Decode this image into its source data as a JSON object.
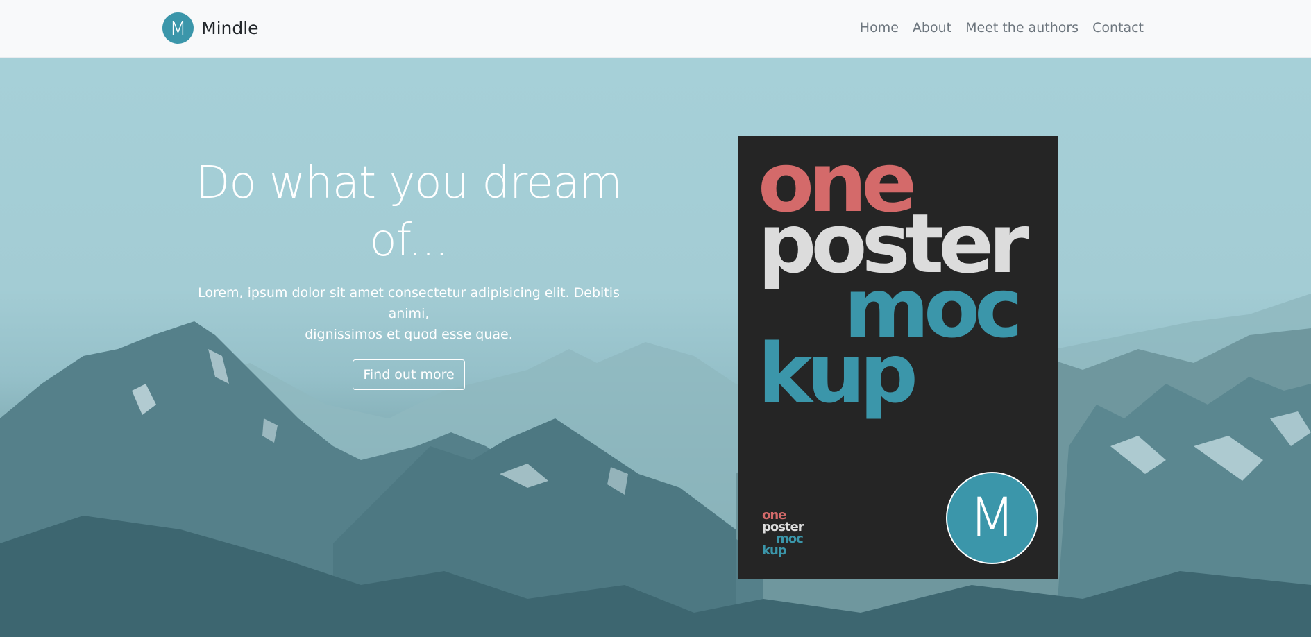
{
  "navbar": {
    "brand_initial": "M",
    "brand_name": "Mindle",
    "links": [
      {
        "label": "Home"
      },
      {
        "label": "About"
      },
      {
        "label": "Meet the authors"
      },
      {
        "label": "Contact"
      }
    ]
  },
  "hero": {
    "title_line1": "Do what you dream",
    "title_line2": "of...",
    "lead_line1": "Lorem, ipsum dolor sit amet consectetur adipisicing elit. Debitis animi,",
    "lead_line2": "dignissimos et quod esse quae.",
    "cta_label": "Find out more",
    "background": "mountain-landscape"
  },
  "poster": {
    "words": [
      "one",
      "poster",
      "moc",
      "kup"
    ],
    "mini_logo": [
      "one",
      "poster",
      "moc",
      "kup"
    ],
    "badge_initial": "M"
  },
  "colors": {
    "brand": "#3b96aa",
    "accent_red": "#d46a6a",
    "poster_bg": "#252525",
    "navbar_bg": "#f8f9fa",
    "sky": "#a6d0d8"
  }
}
